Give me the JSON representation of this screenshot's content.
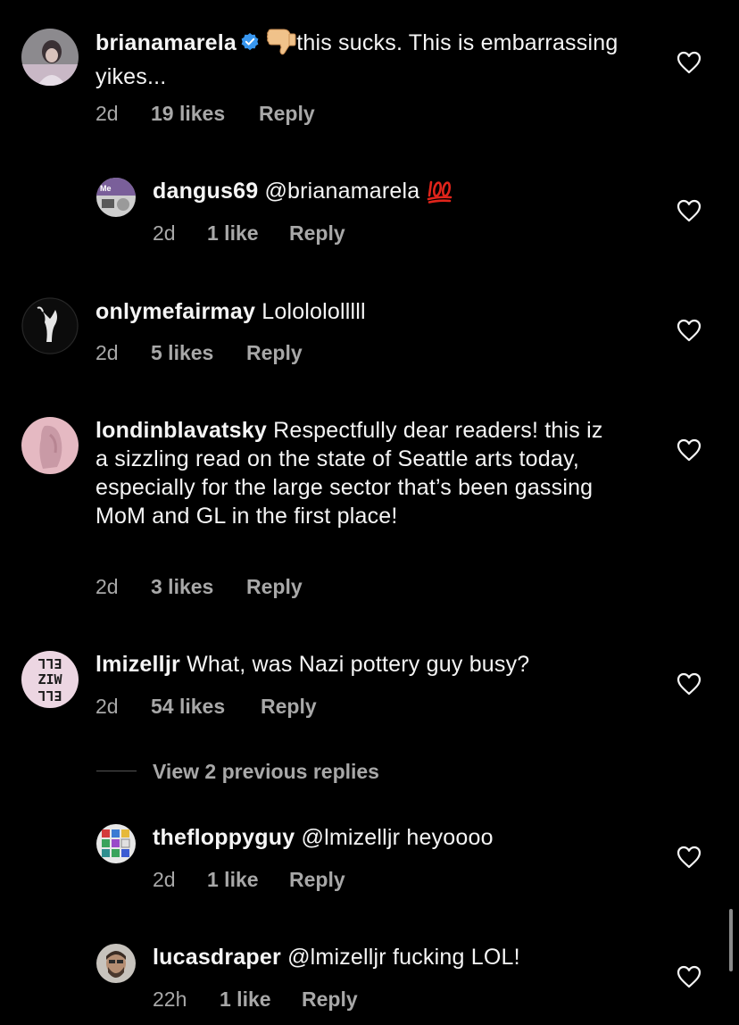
{
  "comments": [
    {
      "username": "brianamarela",
      "verified": true,
      "emoji": "thumbs-down",
      "text": "this sucks. This is embarrassing yikes...",
      "time": "2d",
      "likes": "19 likes",
      "reply": "Reply"
    },
    {
      "username": "dangus69",
      "mention": "@brianamarela",
      "emoji": "hundred-points",
      "text": "",
      "time": "2d",
      "likes": "1 like",
      "reply": "Reply"
    },
    {
      "username": "onlymefairmay",
      "text": "Lololololllll",
      "time": "2d",
      "likes": "5 likes",
      "reply": "Reply"
    },
    {
      "username": "londinblavatsky",
      "text": "Respectfully dear readers! this iz a sizzling read on the state of Seattle arts today, especially  for the large sector that’s been gassing MoM and GL in the first place!",
      "time": "2d",
      "likes": "3 likes",
      "reply": "Reply"
    },
    {
      "username": "lmizelljr",
      "avatar_text": "ELL ZIW ELL",
      "text": "What, was Nazi pottery guy busy?",
      "time": "2d",
      "likes": "54 likes",
      "reply": "Reply"
    },
    {
      "username": "thefloppyguy",
      "mention": "@lmizelljr",
      "text": "heyoooo",
      "time": "2d",
      "likes": "1 like",
      "reply": "Reply"
    },
    {
      "username": "lucasdraper",
      "mention": "@lmizelljr",
      "text": "fucking LOL!",
      "time": "22h",
      "likes": "1 like",
      "reply": "Reply"
    }
  ],
  "view_previous_replies": "View 2 previous replies",
  "colors": {
    "background": "#000000",
    "text": "#f5f5f5",
    "meta": "#a8a8a8",
    "verified": "#3897f0",
    "heart_stroke": "#f5f5f5"
  },
  "icons": {
    "like": "heart-outline-icon",
    "verified": "verified-badge-icon"
  }
}
